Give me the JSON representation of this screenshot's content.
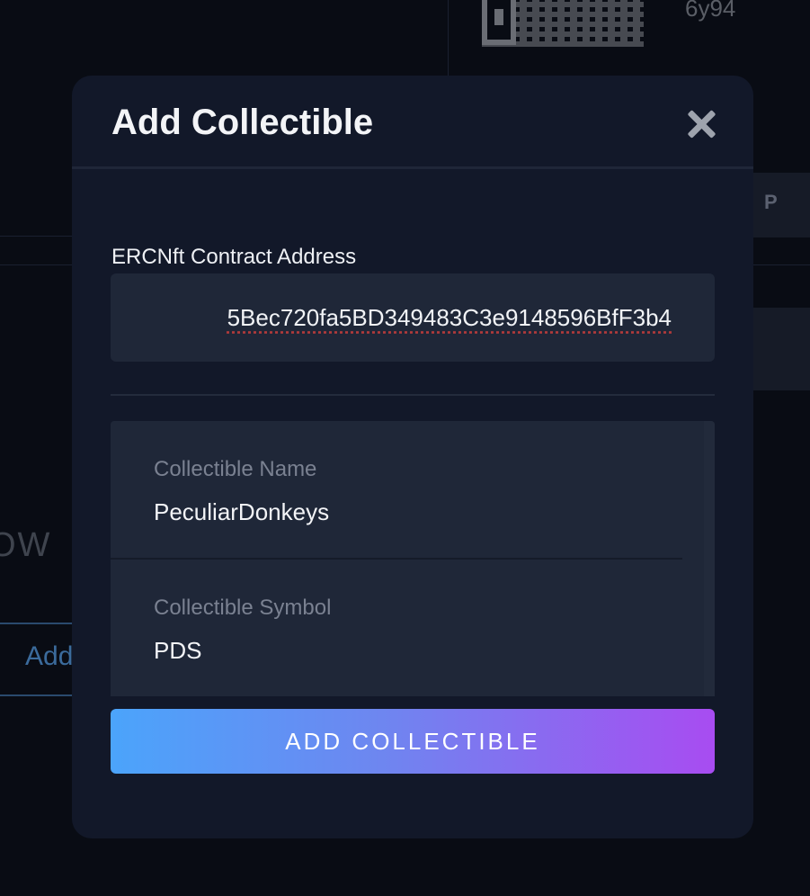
{
  "background": {
    "address_tail": "6y94",
    "side_tab_label": "P",
    "section_heading_fragment": "OW",
    "add_button_fragment": "Add"
  },
  "modal": {
    "title": "Add Collectible",
    "contract_label": "ERCNft Contract Address",
    "contract_address_visible": "5Bec720fa5BD349483C3e9148596BfF3b4",
    "name_label": "Collectible Name",
    "name_value": "PeculiarDonkeys",
    "symbol_label": "Collectible Symbol",
    "symbol_value": "PDS",
    "submit_label": "ADD COLLECTIBLE"
  },
  "colors": {
    "modal_bg": "#121829",
    "field_bg": "#1f2738",
    "gradient_start": "#4ba4fb",
    "gradient_end": "#a84cf1"
  },
  "icons": {
    "close": "close-icon",
    "qr": "qr-code-icon"
  }
}
